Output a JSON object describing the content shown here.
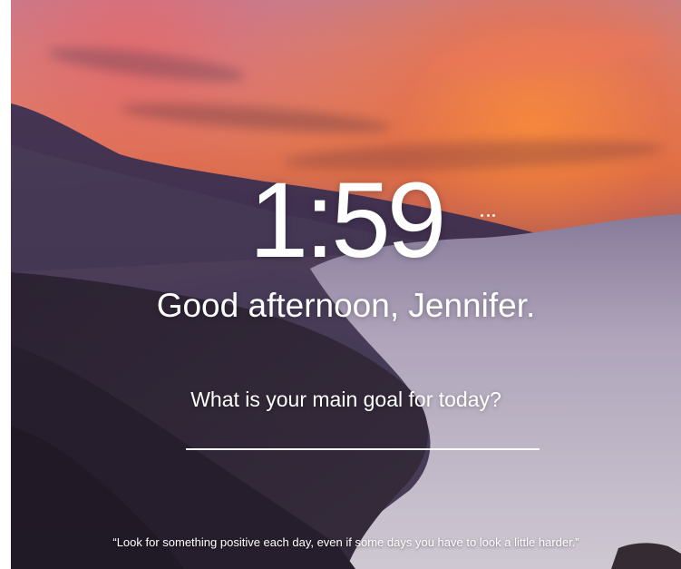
{
  "background": {
    "scene": "sunset-mountain-sea-of-clouds",
    "colors": {
      "sky_top": "#b487a2",
      "sunset_orange": "#e37d4a",
      "mountain_dark": "#2f2538",
      "clouds_light": "#ddd6e3"
    }
  },
  "clock": {
    "time": "1:59",
    "menu_icon": "ellipsis-icon"
  },
  "greeting": {
    "text": "Good afternoon, Jennifer."
  },
  "focus": {
    "prompt": "What is your main goal for today?",
    "input_value": ""
  },
  "quote": {
    "text": "“Look for something positive each day, even if some days you have to look a little harder.”"
  }
}
